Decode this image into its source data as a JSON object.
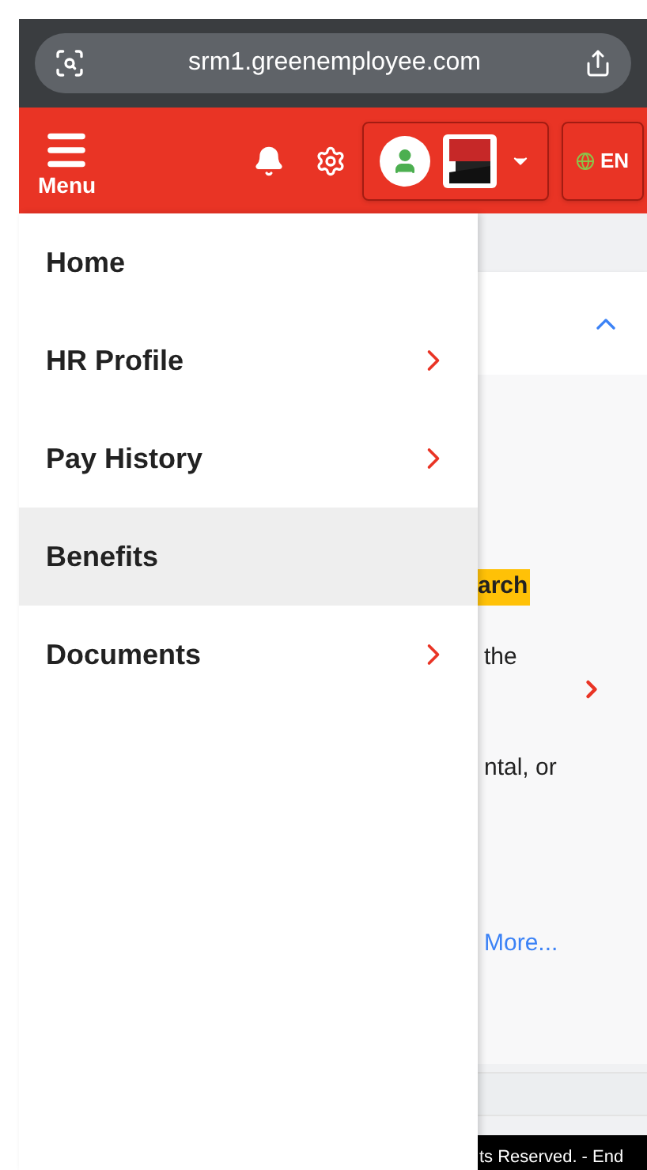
{
  "browser": {
    "url": "srm1.greenemployee.com"
  },
  "header": {
    "menu_label": "Menu",
    "language": "EN"
  },
  "menu": {
    "items": [
      {
        "label": "Home",
        "selected": false,
        "has_submenu": false
      },
      {
        "label": "HR Profile",
        "selected": false,
        "has_submenu": true
      },
      {
        "label": "Pay History",
        "selected": false,
        "has_submenu": true
      },
      {
        "label": "Benefits",
        "selected": true,
        "has_submenu": false
      },
      {
        "label": "Documents",
        "selected": false,
        "has_submenu": true
      }
    ]
  },
  "background": {
    "highlighted_text": "arch",
    "line_1": "the",
    "line_2": "ntal, or",
    "link": "More...",
    "footer": "ts Reserved. - End"
  }
}
